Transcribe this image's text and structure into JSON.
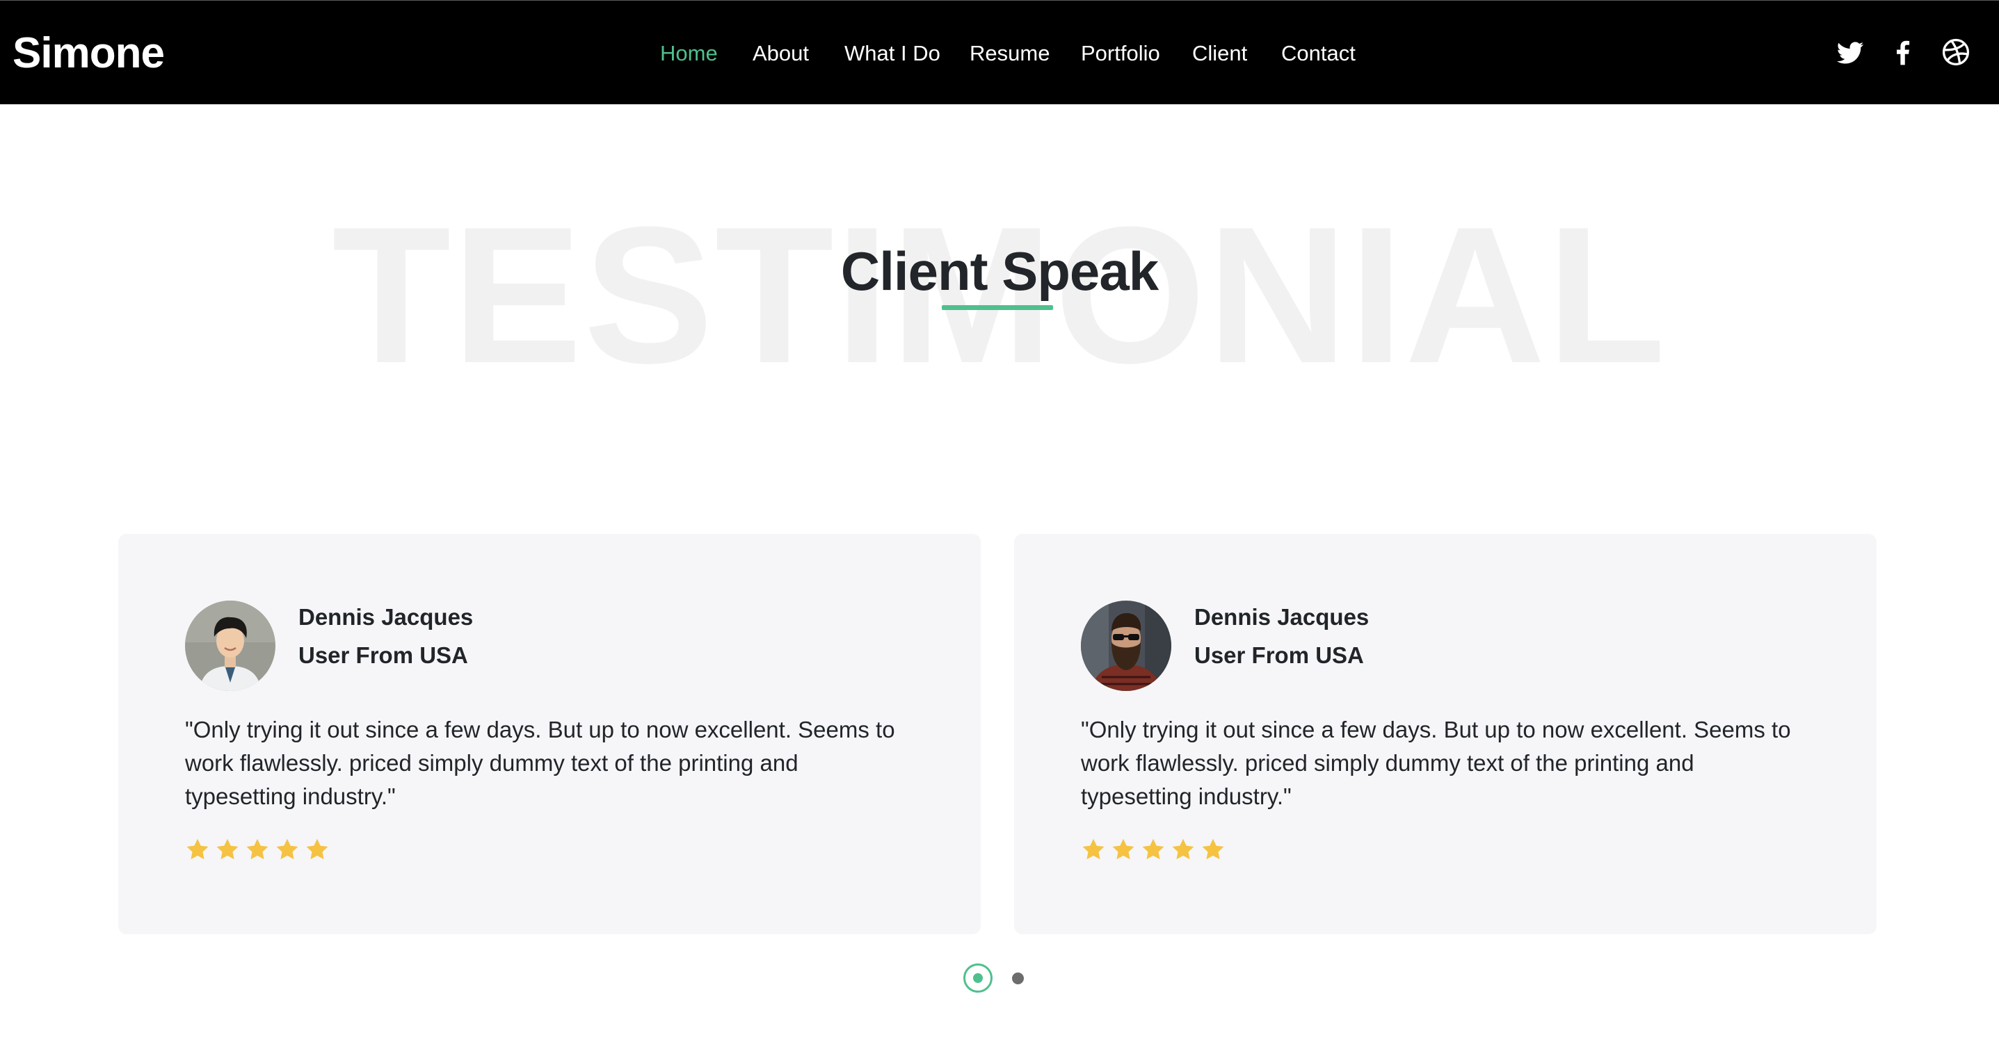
{
  "brand": "Simone",
  "nav": {
    "items": [
      {
        "label": "Home",
        "active": true
      },
      {
        "label": "About",
        "active": false
      },
      {
        "label": "What I Do",
        "active": false
      },
      {
        "label": "Resume",
        "active": false
      },
      {
        "label": "Portfolio",
        "active": false
      },
      {
        "label": "Client",
        "active": false
      },
      {
        "label": "Contact",
        "active": false
      }
    ],
    "social_icons": [
      "twitter-icon",
      "facebook-icon",
      "dribbble-icon"
    ]
  },
  "section": {
    "background_word": "TESTIMONIAL",
    "title": "Client Speak"
  },
  "testimonials": [
    {
      "name": "Dennis Jacques",
      "role": "User From USA",
      "quote": "\"Only trying it out since a few days. But up to now excellent. Seems to work flawlessly. priced simply dummy text of the printing and typesetting industry.\"",
      "rating": 5,
      "avatar": "avatar-young-man-photo"
    },
    {
      "name": "Dennis Jacques",
      "role": "User From USA",
      "quote": "\"Only trying it out since a few days. But up to now excellent. Seems to work flawlessly. priced simply dummy text of the printing and typesetting industry.\"",
      "rating": 5,
      "avatar": "avatar-bearded-man-photo"
    }
  ],
  "pager": {
    "current": 1,
    "total": 2
  },
  "colors": {
    "header_bg": "#000000",
    "accent": "#4fc08d",
    "star": "#f5c242",
    "card_bg": "#f6f6f8"
  }
}
